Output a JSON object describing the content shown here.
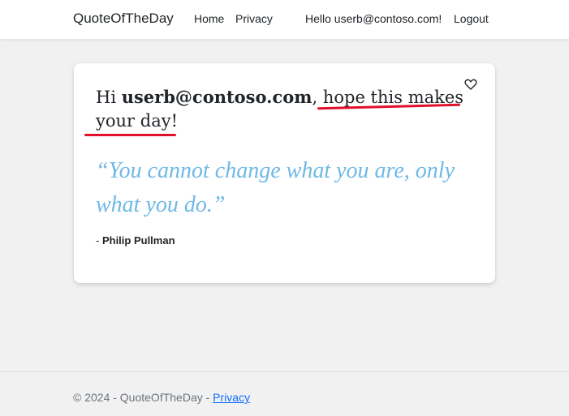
{
  "navbar": {
    "brand": "QuoteOfTheDay",
    "links": [
      {
        "label": "Home"
      },
      {
        "label": "Privacy"
      }
    ],
    "greeting": "Hello userb@contoso.com!",
    "logout_label": "Logout"
  },
  "card": {
    "greeting_prefix": "Hi ",
    "user": "userb@contoso.com",
    "greeting_sep": ", ",
    "greeting_suffix": "hope this makes your day!",
    "quote": "“You cannot change what you are, only what you do.”",
    "author_prefix": "- ",
    "author": "Philip Pullman",
    "favorite_icon": "heart-outline-icon"
  },
  "footer": {
    "text": "© 2024 - QuoteOfTheDay - ",
    "privacy_label": "Privacy"
  },
  "colors": {
    "quote": "#6fb9e6",
    "highlight": "#e0102a",
    "link": "#0d6efd",
    "background": "#f1f1f1"
  }
}
